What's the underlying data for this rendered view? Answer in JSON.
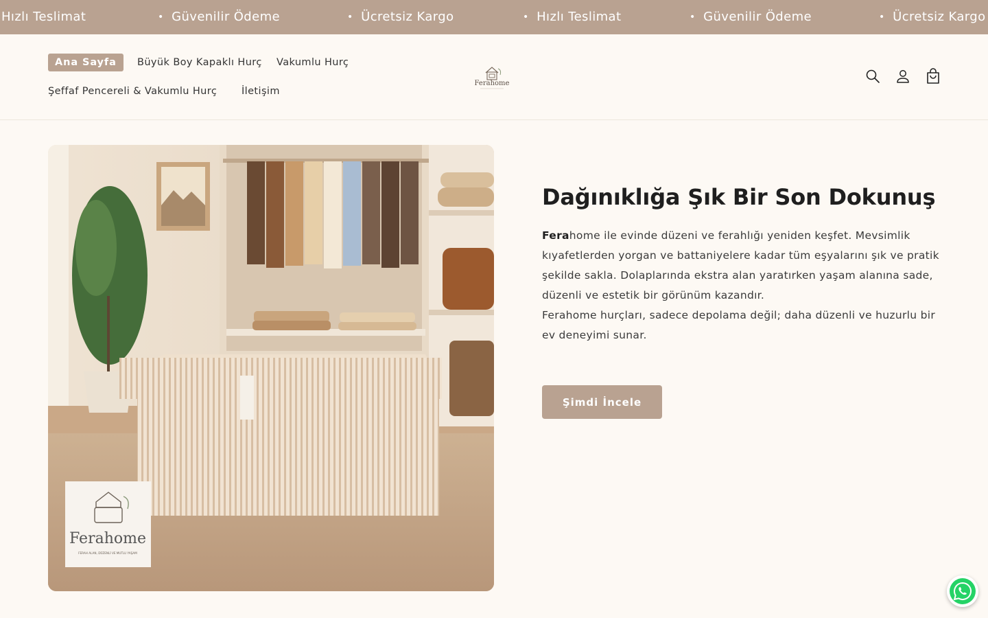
{
  "announcement": {
    "items": [
      {
        "label": "Hızlı Teslimat",
        "bullet": false
      },
      {
        "label": "Güvenilir Ödeme",
        "bullet": true
      },
      {
        "label": "Ücretsiz Kargo",
        "bullet": true
      },
      {
        "label": "Hızlı Teslimat",
        "bullet": true
      },
      {
        "label": "Güvenilir Ödeme",
        "bullet": true
      },
      {
        "label": "Ücretsiz Kargo",
        "bullet": true
      }
    ],
    "bullet": "•"
  },
  "header": {
    "nav": [
      {
        "label": "Ana Sayfa",
        "active": true
      },
      {
        "label": "Büyük Boy Kapaklı Hurç",
        "active": false
      },
      {
        "label": "Vakumlu Hurç",
        "active": false
      },
      {
        "label": "Şeffaf Pencereli & Vakumlu Hurç",
        "active": false
      },
      {
        "label": "İletişim",
        "active": false
      }
    ],
    "logo_text": "Ferahome",
    "icons": [
      "search-icon",
      "account-icon",
      "cart-icon"
    ]
  },
  "hero": {
    "title": "Dağınıklığa Şık Bir Son Dokunuş",
    "brand_bold": "Fera",
    "paragraph1_rest": "home ile evinde düzeni ve ferahlığı yeniden keşfet. Mevsimlik kıyafetlerden yorgan ve battaniyelere kadar tüm eşyalarını şık ve pratik şekilde sakla. Dolaplarında ekstra alan yaratırken yaşam alanına sade, düzenli ve estetik bir görünüm kazandır.",
    "paragraph2": "Ferahome hurçları, sadece depolama değil; daha düzenli ve huzurlu bir ev deneyimi sunar.",
    "cta_label": "Şimdi İncele",
    "image_badge": {
      "brand": "Ferahome",
      "tagline": "FERAH ALAN, DÜZENLİ VE MUTLU YAŞAM"
    }
  },
  "colors": {
    "accent": "#b9a291",
    "background": "#fdf9f4",
    "text": "#1f1f1f",
    "whatsapp": "#25d366"
  },
  "whatsapp": {
    "icon": "whatsapp-icon"
  }
}
